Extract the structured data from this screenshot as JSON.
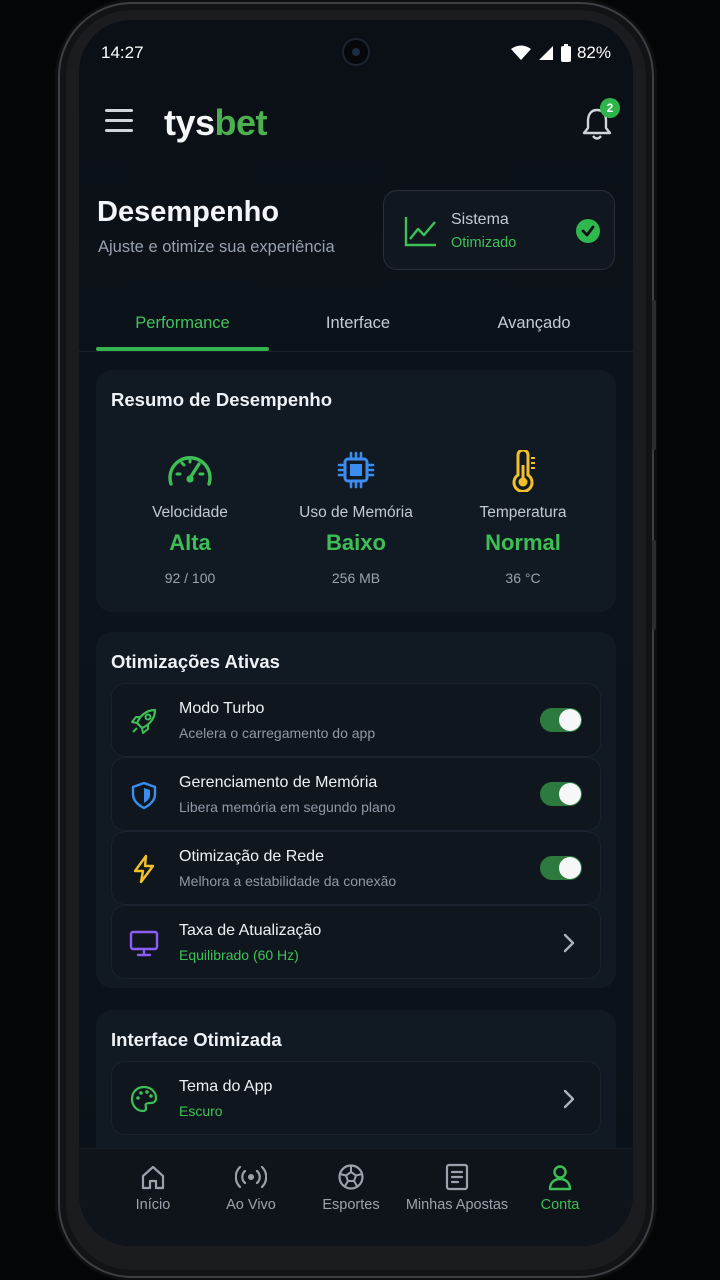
{
  "status_bar": {
    "time": "14:27",
    "battery": "82%"
  },
  "header": {
    "logo_part1": "tys",
    "logo_part2": "bet",
    "notification_count": "2"
  },
  "page": {
    "title": "Desempenho",
    "subtitle": "Ajuste e otimize sua experiência"
  },
  "system_card": {
    "label": "Sistema",
    "status": "Otimizado"
  },
  "tabs": [
    {
      "label": "Performance",
      "active": true
    },
    {
      "label": "Interface",
      "active": false
    },
    {
      "label": "Avançado",
      "active": false
    }
  ],
  "summary": {
    "title": "Resumo de Desempenho",
    "metrics": [
      {
        "icon": "speedometer-icon",
        "label": "Velocidade",
        "value": "Alta",
        "detail": "92 / 100"
      },
      {
        "icon": "chip-icon",
        "label": "Uso de Memória",
        "value": "Baixo",
        "detail": "256 MB"
      },
      {
        "icon": "thermometer-icon",
        "label": "Temperatura",
        "value": "Normal",
        "detail": "36 °C"
      }
    ]
  },
  "optimizations": {
    "title": "Otimizações Ativas",
    "items": [
      {
        "icon": "rocket-icon",
        "title": "Modo Turbo",
        "subtitle": "Acelera o carregamento do app",
        "enabled": true
      },
      {
        "icon": "shield-icon",
        "title": "Gerenciamento de Memória",
        "subtitle": "Libera memória em segundo plano",
        "enabled": true
      },
      {
        "icon": "lightning-icon",
        "title": "Otimização de Rede",
        "subtitle": "Melhora a estabilidade da conexão",
        "enabled": true
      },
      {
        "icon": "monitor-icon",
        "title": "Taxa de Atualização",
        "subtitle": "Equilibrado (60 Hz)"
      }
    ]
  },
  "interface": {
    "title": "Interface Otimizada",
    "items": [
      {
        "icon": "palette-icon",
        "title": "Tema do App",
        "subtitle": "Escuro"
      }
    ]
  },
  "bottom_nav": [
    {
      "icon": "home-icon",
      "label": "Início",
      "active": false
    },
    {
      "icon": "broadcast-icon",
      "label": "Ao Vivo",
      "active": false
    },
    {
      "icon": "soccer-ball-icon",
      "label": "Esportes",
      "active": false
    },
    {
      "icon": "receipt-icon",
      "label": "Minhas Apostas",
      "active": false
    },
    {
      "icon": "user-icon",
      "label": "Conta",
      "active": true
    }
  ],
  "colors": {
    "accent": "#3dbf56",
    "background": "#0b1016",
    "card": "#111922"
  }
}
